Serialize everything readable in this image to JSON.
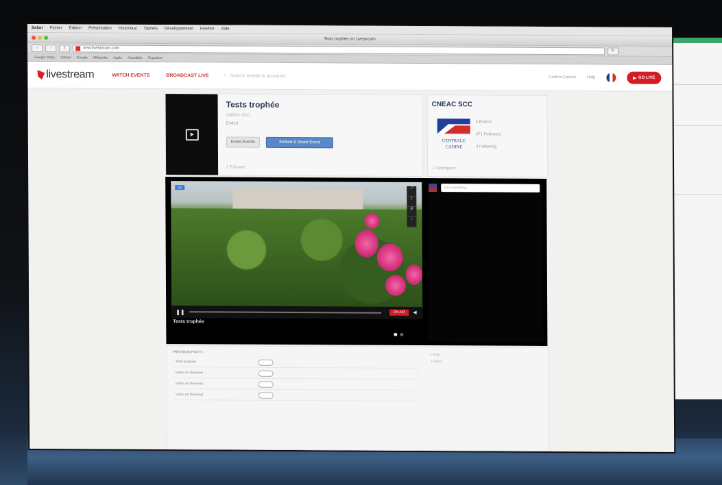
{
  "browser": {
    "menu": [
      "Safari",
      "Fichier",
      "Édition",
      "Présentation",
      "Historique",
      "Signets",
      "Développement",
      "Fenêtre",
      "Aide"
    ],
    "window_title": "Tests trophée on Livestream",
    "url": "new.livestream.com",
    "bookmarks": [
      "Google Maps",
      "Yahoo!",
      "Google",
      "Wikipédia",
      "Apple",
      "Actualités",
      "Populaire"
    ]
  },
  "header": {
    "logo": "livestream",
    "nav": [
      "WATCH EVENTS",
      "BROADCAST LIVE"
    ],
    "search_placeholder": "Search events & accounts",
    "account_link": "Central Canine",
    "help_link": "Help",
    "go_live": "GO LIVE"
  },
  "event": {
    "title": "Tests trophée",
    "owner": "CNEAC SCC",
    "dates": "Ended",
    "button_edit": "Event Events",
    "button_primary": "Embed & Share Event",
    "followers": "1 Follower"
  },
  "account": {
    "name": "CNEAC SCC",
    "logo_text_1": "CENTRALE",
    "logo_text_2": "CANINE",
    "stat_events": "4 Events",
    "stat_followers": "471 Followers",
    "stat_following": "3 Following",
    "foot": "1 Participant"
  },
  "player": {
    "onair": "ON AIR",
    "video_title": "Tests trophée",
    "chat_placeholder": "Say something...",
    "hd": "HD"
  },
  "playlist": {
    "header": "PREVIOUS POSTS",
    "items": [
      "Tests trophée",
      "Video on Demand",
      "Video on Demand",
      "Video on Demand"
    ],
    "side": [
      "1 Post",
      "1 Video"
    ]
  },
  "colors": {
    "brand_red": "#d31c24",
    "link_red": "#c0392b",
    "title_navy": "#2b3a55",
    "button_blue": "#5a87c7"
  }
}
